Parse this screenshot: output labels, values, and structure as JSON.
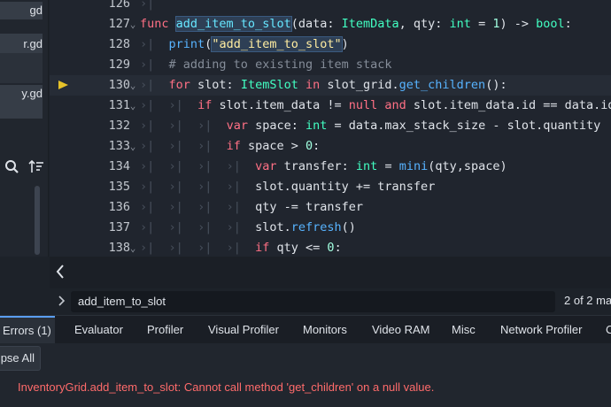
{
  "file_panel": {
    "items": [
      {
        "label": "gd",
        "highlighted": true
      },
      {
        "label": "r.gd",
        "highlighted": true
      },
      {
        "label": "y.gd",
        "highlighted": true
      }
    ],
    "search_icon": "search-icon",
    "sort_icon": "sort-icon"
  },
  "editor": {
    "lines": [
      {
        "number": "126"
      },
      {
        "number": "127"
      },
      {
        "number": "128"
      },
      {
        "number": "129"
      },
      {
        "number": "130"
      },
      {
        "number": "131"
      },
      {
        "number": "132"
      },
      {
        "number": "133"
      },
      {
        "number": "134"
      },
      {
        "number": "135"
      },
      {
        "number": "136"
      },
      {
        "number": "137"
      },
      {
        "number": "138"
      }
    ],
    "tokens": {
      "l127_func": "func",
      "l127_name": "add_item_to_slot",
      "l127_p1": "(data: ",
      "l127_t1": "ItemData",
      "l127_p2": ", qty: ",
      "l127_t2": "int",
      "l127_p3": " = ",
      "l127_n1": "1",
      "l127_p4": ") -> ",
      "l127_t3": "bool",
      "l127_p5": ":",
      "l128_fn": "print",
      "l128_p1": "(",
      "l128_s": "\"add_item_to_slot\"",
      "l128_p2": ")",
      "l129_cm": "# adding to existing item stack",
      "l130_for": "for",
      "l130_p1": " slot: ",
      "l130_t": "ItemSlot",
      "l130_in": " in",
      "l130_p2": " slot_grid.",
      "l130_fn": "get_children",
      "l130_p3": "():",
      "l131_if": "if",
      "l131_p1": " slot.item_data != ",
      "l131_null": "null",
      "l131_and": " and",
      "l131_p2": " slot.item_data.id == data.id:",
      "l132_var": "var",
      "l132_p1": " space: ",
      "l132_t": "int",
      "l132_p2": " = data.max_stack_size - slot.quantity",
      "l133_if": "if",
      "l133_p1": " space > ",
      "l133_n": "0",
      "l133_p2": ":",
      "l134_var": "var",
      "l134_p1": " transfer: ",
      "l134_t": "int",
      "l134_p2": " = ",
      "l134_fn": "mini",
      "l134_p3": "(qty,space)",
      "l135": "slot.quantity += transfer",
      "l136": "qty -= transfer",
      "l137_p1": "slot.",
      "l137_fn": "refresh",
      "l137_p2": "()",
      "l138_if": "if",
      "l138_p1": " qty <= ",
      "l138_n": "0",
      "l138_p2": ":"
    },
    "tab_glyph": "›|",
    "fold_glyph": "⌄",
    "breakpoint_line": "130"
  },
  "scroll_back_icon": "chevron-left-icon",
  "find_bar": {
    "value": "add_item_to_slot",
    "count": "2 of 2 ma"
  },
  "bottom_tabs": [
    {
      "label": "Errors (1)",
      "active": true
    },
    {
      "label": "Evaluator"
    },
    {
      "label": "Profiler"
    },
    {
      "label": "Visual Profiler"
    },
    {
      "label": "Monitors"
    },
    {
      "label": "Video RAM"
    },
    {
      "label": "Misc"
    },
    {
      "label": "Network Profiler"
    },
    {
      "label": "C"
    }
  ],
  "collapse_all_label": "pse All",
  "error_message": "InventoryGrid.add_item_to_slot: Cannot call method 'get_children' on a null value.",
  "colors": {
    "keyword": "#ff7085",
    "function": "#57b3ff",
    "type": "#42ffc2",
    "string": "#ffeda1",
    "comment": "#858d99",
    "error": "#ff6b6b",
    "breakpoint_arrow": "#e6c229"
  }
}
